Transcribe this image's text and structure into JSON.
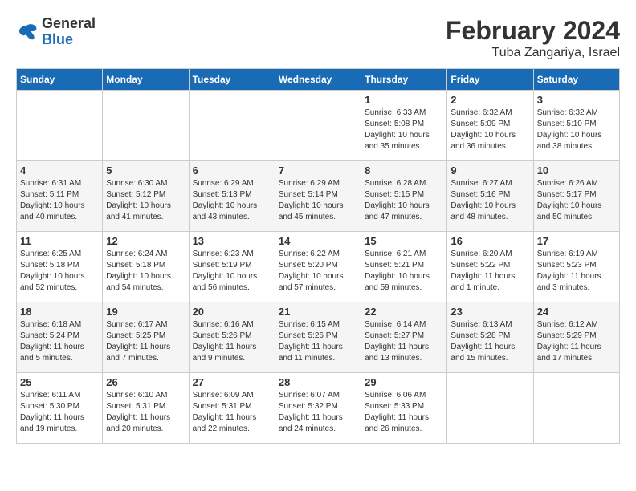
{
  "header": {
    "logo_general": "General",
    "logo_blue": "Blue",
    "title": "February 2024",
    "subtitle": "Tuba Zangariya, Israel"
  },
  "days_of_week": [
    "Sunday",
    "Monday",
    "Tuesday",
    "Wednesday",
    "Thursday",
    "Friday",
    "Saturday"
  ],
  "weeks": [
    {
      "days": [
        {
          "num": "",
          "info": ""
        },
        {
          "num": "",
          "info": ""
        },
        {
          "num": "",
          "info": ""
        },
        {
          "num": "",
          "info": ""
        },
        {
          "num": "1",
          "info": "Sunrise: 6:33 AM\nSunset: 5:08 PM\nDaylight: 10 hours\nand 35 minutes."
        },
        {
          "num": "2",
          "info": "Sunrise: 6:32 AM\nSunset: 5:09 PM\nDaylight: 10 hours\nand 36 minutes."
        },
        {
          "num": "3",
          "info": "Sunrise: 6:32 AM\nSunset: 5:10 PM\nDaylight: 10 hours\nand 38 minutes."
        }
      ]
    },
    {
      "days": [
        {
          "num": "4",
          "info": "Sunrise: 6:31 AM\nSunset: 5:11 PM\nDaylight: 10 hours\nand 40 minutes."
        },
        {
          "num": "5",
          "info": "Sunrise: 6:30 AM\nSunset: 5:12 PM\nDaylight: 10 hours\nand 41 minutes."
        },
        {
          "num": "6",
          "info": "Sunrise: 6:29 AM\nSunset: 5:13 PM\nDaylight: 10 hours\nand 43 minutes."
        },
        {
          "num": "7",
          "info": "Sunrise: 6:29 AM\nSunset: 5:14 PM\nDaylight: 10 hours\nand 45 minutes."
        },
        {
          "num": "8",
          "info": "Sunrise: 6:28 AM\nSunset: 5:15 PM\nDaylight: 10 hours\nand 47 minutes."
        },
        {
          "num": "9",
          "info": "Sunrise: 6:27 AM\nSunset: 5:16 PM\nDaylight: 10 hours\nand 48 minutes."
        },
        {
          "num": "10",
          "info": "Sunrise: 6:26 AM\nSunset: 5:17 PM\nDaylight: 10 hours\nand 50 minutes."
        }
      ]
    },
    {
      "days": [
        {
          "num": "11",
          "info": "Sunrise: 6:25 AM\nSunset: 5:18 PM\nDaylight: 10 hours\nand 52 minutes."
        },
        {
          "num": "12",
          "info": "Sunrise: 6:24 AM\nSunset: 5:18 PM\nDaylight: 10 hours\nand 54 minutes."
        },
        {
          "num": "13",
          "info": "Sunrise: 6:23 AM\nSunset: 5:19 PM\nDaylight: 10 hours\nand 56 minutes."
        },
        {
          "num": "14",
          "info": "Sunrise: 6:22 AM\nSunset: 5:20 PM\nDaylight: 10 hours\nand 57 minutes."
        },
        {
          "num": "15",
          "info": "Sunrise: 6:21 AM\nSunset: 5:21 PM\nDaylight: 10 hours\nand 59 minutes."
        },
        {
          "num": "16",
          "info": "Sunrise: 6:20 AM\nSunset: 5:22 PM\nDaylight: 11 hours\nand 1 minute."
        },
        {
          "num": "17",
          "info": "Sunrise: 6:19 AM\nSunset: 5:23 PM\nDaylight: 11 hours\nand 3 minutes."
        }
      ]
    },
    {
      "days": [
        {
          "num": "18",
          "info": "Sunrise: 6:18 AM\nSunset: 5:24 PM\nDaylight: 11 hours\nand 5 minutes."
        },
        {
          "num": "19",
          "info": "Sunrise: 6:17 AM\nSunset: 5:25 PM\nDaylight: 11 hours\nand 7 minutes."
        },
        {
          "num": "20",
          "info": "Sunrise: 6:16 AM\nSunset: 5:26 PM\nDaylight: 11 hours\nand 9 minutes."
        },
        {
          "num": "21",
          "info": "Sunrise: 6:15 AM\nSunset: 5:26 PM\nDaylight: 11 hours\nand 11 minutes."
        },
        {
          "num": "22",
          "info": "Sunrise: 6:14 AM\nSunset: 5:27 PM\nDaylight: 11 hours\nand 13 minutes."
        },
        {
          "num": "23",
          "info": "Sunrise: 6:13 AM\nSunset: 5:28 PM\nDaylight: 11 hours\nand 15 minutes."
        },
        {
          "num": "24",
          "info": "Sunrise: 6:12 AM\nSunset: 5:29 PM\nDaylight: 11 hours\nand 17 minutes."
        }
      ]
    },
    {
      "days": [
        {
          "num": "25",
          "info": "Sunrise: 6:11 AM\nSunset: 5:30 PM\nDaylight: 11 hours\nand 19 minutes."
        },
        {
          "num": "26",
          "info": "Sunrise: 6:10 AM\nSunset: 5:31 PM\nDaylight: 11 hours\nand 20 minutes."
        },
        {
          "num": "27",
          "info": "Sunrise: 6:09 AM\nSunset: 5:31 PM\nDaylight: 11 hours\nand 22 minutes."
        },
        {
          "num": "28",
          "info": "Sunrise: 6:07 AM\nSunset: 5:32 PM\nDaylight: 11 hours\nand 24 minutes."
        },
        {
          "num": "29",
          "info": "Sunrise: 6:06 AM\nSunset: 5:33 PM\nDaylight: 11 hours\nand 26 minutes."
        },
        {
          "num": "",
          "info": ""
        },
        {
          "num": "",
          "info": ""
        }
      ]
    }
  ]
}
